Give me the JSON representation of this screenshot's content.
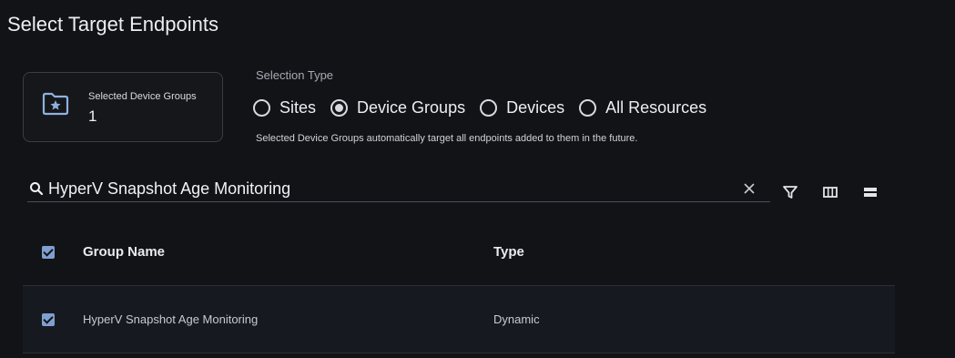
{
  "page": {
    "title": "Select Target Endpoints"
  },
  "summary": {
    "label": "Selected Device Groups",
    "count": "1",
    "icon": "folder-star-icon"
  },
  "selection_type": {
    "label": "Selection Type",
    "options": [
      {
        "label": "Sites",
        "checked": false
      },
      {
        "label": "Device Groups",
        "checked": true
      },
      {
        "label": "Devices",
        "checked": false
      },
      {
        "label": "All Resources",
        "checked": false
      }
    ],
    "helper": "Selected Device Groups automatically target all endpoints added to them in the future."
  },
  "search": {
    "value": "HyperV Snapshot Age Monitoring"
  },
  "toolbar": {
    "icons": [
      "filter-icon",
      "columns-icon",
      "density-icon"
    ]
  },
  "table": {
    "columns": [
      "Group Name",
      "Type"
    ],
    "rows": [
      {
        "name": "HyperV Snapshot Age Monitoring",
        "type": "Dynamic",
        "checked": true
      }
    ]
  },
  "colors": {
    "background": "#111317",
    "accent": "#7f9fcf",
    "row_bg": "#161a20"
  }
}
